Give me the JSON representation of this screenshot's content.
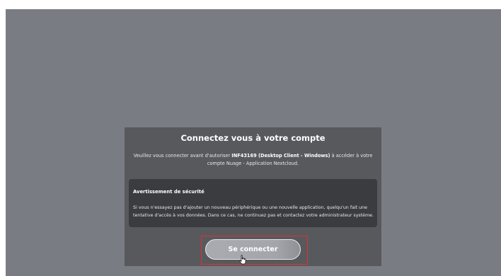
{
  "login": {
    "title": "Connectez vous à votre compte",
    "desc_prefix": "Veuillez vous connecter avant d'autoriser ",
    "app_name": "INF43169 (Desktop Client - Windows)",
    "desc_suffix": " à accéder à votre compte Nuage - Application Nextcloud.",
    "warning_title": "Avertissement de sécurité",
    "warning_text": "Si vous n'essayez pas d'ajouter un nouveau périphérique ou une nouvelle application, quelqu'un fait une tentative d'accès à vos données. Dans ce cas, ne continuez pas et contactez votre administrateur système.",
    "button_label": "Se connecter"
  },
  "colors": {
    "backdrop": "#7a7c84",
    "card": "#58595d",
    "warning_box": "#3b3c40",
    "highlight": "#e03030"
  },
  "icons": {
    "cursor": "hand-pointer-icon"
  }
}
